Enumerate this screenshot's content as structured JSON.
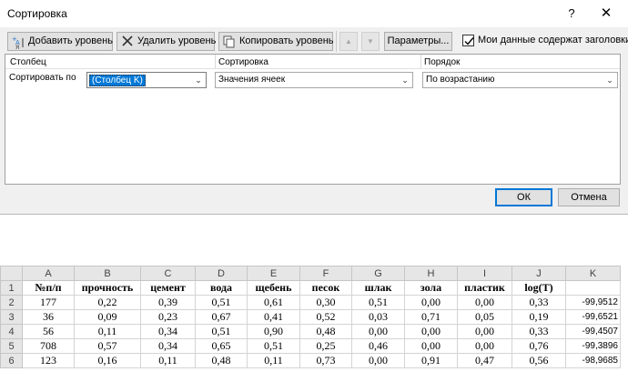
{
  "dialog": {
    "title": "Сортировка",
    "help": "?",
    "close": "✕",
    "toolbar": {
      "add_level": "Добавить уровень",
      "delete_level": "Удалить уровень",
      "copy_level": "Копировать уровень",
      "move_up": "▲",
      "move_down": "▼",
      "options": "Параметры...",
      "headers_checkbox": "Мои данные содержат заголовки",
      "headers_checked": true
    },
    "columns": {
      "column": "Столбец",
      "sort_on": "Сортировка",
      "order": "Порядок"
    },
    "level": {
      "label": "Сортировать по",
      "column_value": "(Столбец K)",
      "sort_on_value": "Значения ячеек",
      "order_value": "По возрастанию"
    },
    "ok": "ОК",
    "cancel": "Отмена"
  },
  "sheet": {
    "column_headers": [
      "A",
      "B",
      "C",
      "D",
      "E",
      "F",
      "G",
      "H",
      "I",
      "J",
      "K"
    ],
    "row_numbers": [
      "1",
      "2",
      "3",
      "4",
      "5",
      "6"
    ],
    "header_row": [
      "№п/п",
      "прочность",
      "цемент",
      "вода",
      "щебень",
      "песок",
      "шлак",
      "зола",
      "пластик",
      "log(T)",
      ""
    ],
    "rows": [
      [
        "177",
        "0,22",
        "0,39",
        "0,51",
        "0,61",
        "0,30",
        "0,51",
        "0,00",
        "0,00",
        "0,33",
        "-99,9512"
      ],
      [
        "36",
        "0,09",
        "0,23",
        "0,67",
        "0,41",
        "0,52",
        "0,03",
        "0,71",
        "0,05",
        "0,19",
        "-99,6521"
      ],
      [
        "56",
        "0,11",
        "0,34",
        "0,51",
        "0,90",
        "0,48",
        "0,00",
        "0,00",
        "0,00",
        "0,33",
        "-99,4507"
      ],
      [
        "708",
        "0,57",
        "0,34",
        "0,65",
        "0,51",
        "0,25",
        "0,46",
        "0,00",
        "0,00",
        "0,76",
        "-99,3896"
      ],
      [
        "123",
        "0,16",
        "0,11",
        "0,48",
        "0,11",
        "0,73",
        "0,00",
        "0,91",
        "0,47",
        "0,56",
        "-98,9685"
      ]
    ]
  }
}
